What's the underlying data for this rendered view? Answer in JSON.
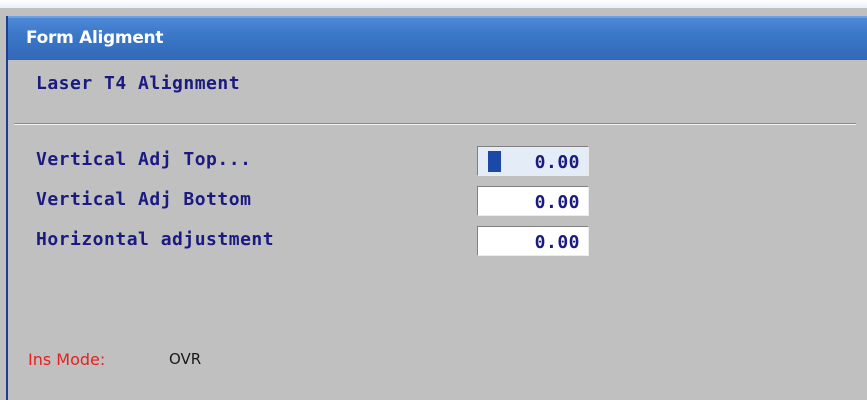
{
  "window": {
    "title": "Form Aligment"
  },
  "form": {
    "subtitle": "Laser T4 Alignment",
    "fields": [
      {
        "label": "Vertical Adj Top...",
        "value": "0.00",
        "focused": true
      },
      {
        "label": "Vertical Adj Bottom",
        "value": "0.00",
        "focused": false
      },
      {
        "label": "Horizontal adjustment",
        "value": "0.00",
        "focused": false
      }
    ]
  },
  "status": {
    "label": "Ins Mode:",
    "value": "OVR"
  },
  "colors": {
    "title_bar": "#3c78c8",
    "text_primary": "#1a1a80",
    "status_label": "#e82020",
    "background": "#c0c0c0"
  }
}
